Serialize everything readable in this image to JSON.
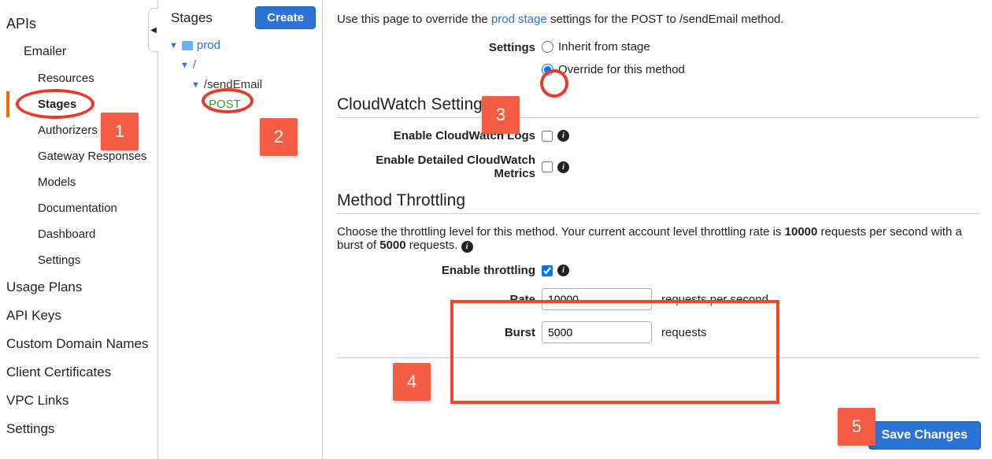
{
  "sidebar": {
    "title": "APIs",
    "api_name": "Emailer",
    "items": [
      "Resources",
      "Stages",
      "Authorizers",
      "Gateway Responses",
      "Models",
      "Documentation",
      "Dashboard",
      "Settings"
    ],
    "active_index": 1,
    "bottom": [
      "Usage Plans",
      "API Keys",
      "Custom Domain Names",
      "Client Certificates",
      "VPC Links",
      "Settings"
    ]
  },
  "stages": {
    "title": "Stages",
    "create_label": "Create",
    "prod": "prod",
    "slash": "/",
    "endpoint": "/sendEmail",
    "method": "POST"
  },
  "main": {
    "intro_pre": "Use this page to override the ",
    "intro_link": "prod stage",
    "intro_post": " settings for the POST to /sendEmail method.",
    "settings_label": "Settings",
    "radio_inherit": "Inherit from stage",
    "radio_override": "Override for this method",
    "cw_heading": "CloudWatch Settings",
    "cw_logs_label": "Enable CloudWatch Logs",
    "cw_metrics_label": "Enable Detailed CloudWatch Metrics",
    "throttle_heading": "Method Throttling",
    "throttle_para_pre": "Choose the throttling level for this method. Your current account level throttling rate is ",
    "throttle_rate_bold": "10000",
    "throttle_para_mid": " requests per second with a burst of ",
    "throttle_burst_bold": "5000",
    "throttle_para_post": " requests. ",
    "enable_throttling_label": "Enable throttling",
    "rate_label": "Rate",
    "rate_value": "10000",
    "rate_unit": "requests per second",
    "burst_label": "Burst",
    "burst_value": "5000",
    "burst_unit": "requests",
    "save_label": "Save Changes"
  },
  "annotations": {
    "n1": "1",
    "n2": "2",
    "n3": "3",
    "n4": "4",
    "n5": "5"
  }
}
